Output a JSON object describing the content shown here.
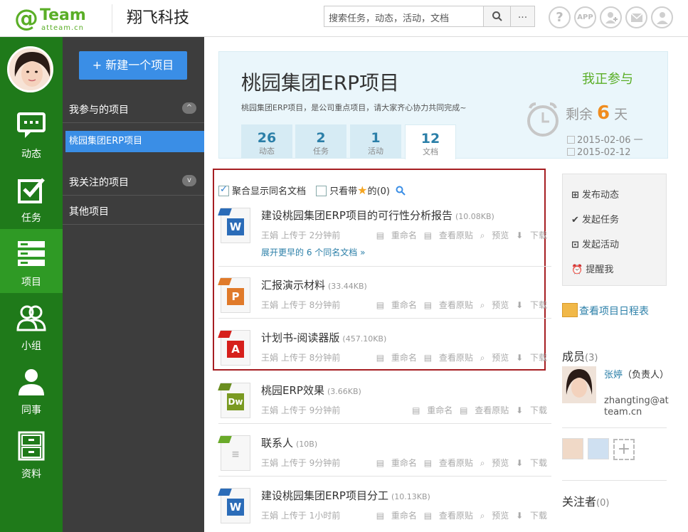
{
  "header": {
    "logo_at": "@",
    "logo_team": "Team",
    "logo_domain": "atteam.cn",
    "company": "翔飞科技",
    "search_placeholder": "搜索任务，动态，活动，文档",
    "more_label": "...",
    "icons": [
      "help-icon",
      "app-icon",
      "add-user-icon",
      "mail-icon",
      "user-icon"
    ],
    "app_label": "APP",
    "help_label": "?"
  },
  "leftnav": {
    "items": [
      {
        "label": "动态",
        "icon": "chat-icon"
      },
      {
        "label": "任务",
        "icon": "task-check-icon"
      },
      {
        "label": "项目",
        "icon": "project-list-icon"
      },
      {
        "label": "小组",
        "icon": "group-icon"
      },
      {
        "label": "同事",
        "icon": "colleague-icon"
      },
      {
        "label": "资料",
        "icon": "cabinet-icon"
      }
    ],
    "active_index": 2
  },
  "projside": {
    "new_button": "+ 新建一个项目",
    "my_projects": "我参与的项目",
    "my_projects_toggle": "^",
    "active_project": "桃园集团ERP项目",
    "followed_projects": "我关注的项目",
    "followed_toggle": "v",
    "other_projects": "其他项目"
  },
  "project": {
    "title": "桃园集团ERP项目",
    "desc": "桃园集团ERP项目，是公司重点项目，请大家齐心协力共同完成~",
    "status": "我正参与",
    "remain_prefix": "剩余",
    "remain_days": "6",
    "remain_suffix": "天",
    "start_date": "2015-02-06 一",
    "end_date": "2015-02-12",
    "tabs": [
      {
        "num": "26",
        "label": "动态"
      },
      {
        "num": "2",
        "label": "任务"
      },
      {
        "num": "1",
        "label": "活动"
      },
      {
        "num": "12",
        "label": "文档"
      }
    ],
    "active_tab": 3
  },
  "filters": {
    "merge_label": "聚合显示同名文档",
    "merge_checked": true,
    "star_prefix": "只看带",
    "star_suffix": "的(0)"
  },
  "docs": [
    {
      "title": "建设桃园集团ERP项目的可行性分析报告",
      "size": "(10.08KB)",
      "type": "word",
      "meta": "王娟  上传于  2分钟前",
      "actions": [
        "重命名",
        "查看原贴",
        "预览",
        "下载"
      ],
      "expand": "展开更早的 6 个同名文档"
    },
    {
      "title": "汇报演示材料",
      "size": "(33.44KB)",
      "type": "ppt",
      "meta": "王娟  上传于  8分钟前",
      "actions": [
        "重命名",
        "查看原贴",
        "预览",
        "下载"
      ]
    },
    {
      "title": "计划书-阅读器版",
      "size": "(457.10KB)",
      "type": "pdf",
      "meta": "王娟  上传于  8分钟前",
      "actions": [
        "重命名",
        "查看原贴",
        "预览",
        "下载"
      ]
    },
    {
      "title": "桃园ERP效果",
      "size": "(3.66KB)",
      "type": "dw",
      "meta": "王娟  上传于  9分钟前",
      "actions": [
        "重命名",
        "查看原贴",
        "下载"
      ]
    },
    {
      "title": "联系人",
      "size": "(10B)",
      "type": "txt",
      "meta": "王娟  上传于  9分钟前",
      "actions": [
        "重命名",
        "查看原贴",
        "预览",
        "下载"
      ]
    },
    {
      "title": "建设桃园集团ERP项目分工",
      "size": "(10.13KB)",
      "type": "word",
      "meta": "王娟  上传于  1小时前",
      "actions": [
        "重命名",
        "查看原贴",
        "预览",
        "下载"
      ]
    }
  ],
  "right": {
    "actions": [
      "发布动态",
      "发起任务",
      "发起活动",
      "提醒我"
    ],
    "schedule": "查看项目日程表",
    "members_title": "成员",
    "members_count": "(3)",
    "member_name": "张婷",
    "member_role": "（负责人）",
    "member_email": "zhangting@atteam.cn",
    "followers_title": "关注者",
    "followers_count": "(0)"
  },
  "colors": {
    "brand_green": "#5aae27",
    "nav_green": "#1f7a1a",
    "blue": "#3a8ee6",
    "link": "#2b7fa8",
    "orange": "#f08c1e",
    "red_box": "#a61e22"
  }
}
